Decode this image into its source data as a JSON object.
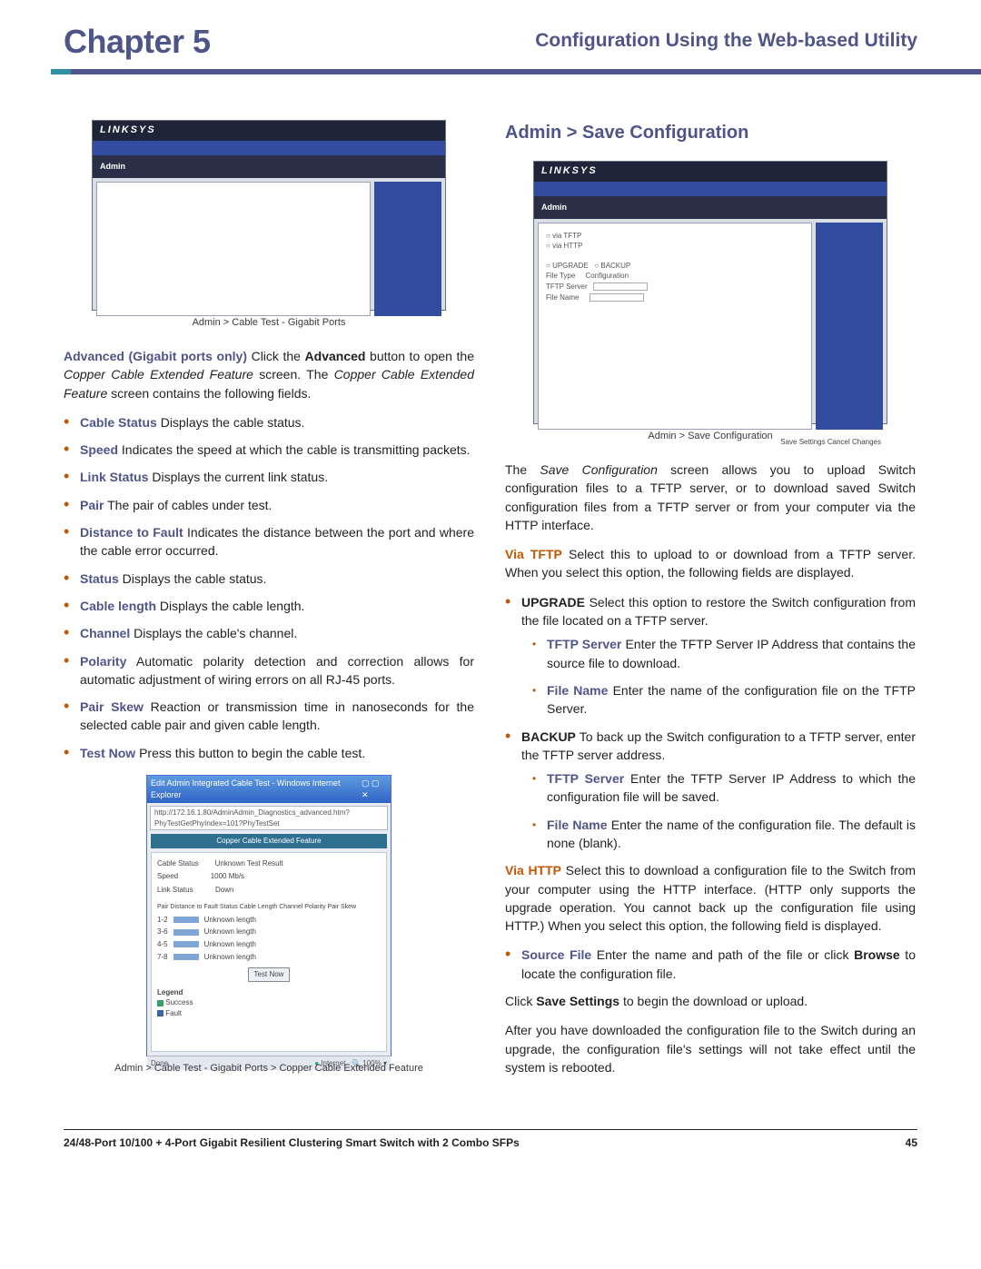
{
  "header": {
    "chapter": "Chapter 5",
    "section": "Configuration Using the Web-based Utility"
  },
  "left": {
    "fig1": {
      "logo": "LINKSYS",
      "nav": "Admin",
      "caption": "Admin > Cable Test - Gigabit Ports"
    },
    "intro": {
      "lead_bold": "Advanced (Gigabit ports only)",
      "lead_rest": " Click the ",
      "lead_bold2": "Advanced",
      "sent2a": " button to open the ",
      "sent2i": "Copper Cable Extended Feature",
      "sent2b": " screen. The ",
      "sent2i2": "Copper Cable Extended Feature",
      "sent2c": " screen contains the following fields."
    },
    "bullets": [
      {
        "term": "Cable Status",
        "text": "  Displays the cable status."
      },
      {
        "term": "Speed",
        "text": " Indicates the speed at which the cable is transmitting packets."
      },
      {
        "term": "Link Status",
        "text": "  Displays the current link status."
      },
      {
        "term": "Pair",
        "text": "  The pair of cables under test."
      },
      {
        "term": "Distance to Fault",
        "text": "  Indicates the distance between the port and where the cable error occurred."
      },
      {
        "term": "Status",
        "text": "  Displays the cable status."
      },
      {
        "term": "Cable length",
        "text": "  Displays the cable length."
      },
      {
        "term": "Channel",
        "text": "  Displays the cable's channel."
      },
      {
        "term": "Polarity",
        "text": "  Automatic polarity detection and correction allows for automatic adjustment of wiring errors on all RJ-45 ports."
      },
      {
        "term": "Pair Skew",
        "text": " Reaction or transmission time in nanoseconds for the selected cable pair and given cable length."
      },
      {
        "term": "Test Now",
        "text": "  Press this button to begin the cable test."
      }
    ],
    "fig2": {
      "title": "Edit Admin Integrated Cable Test - Windows Internet Explorer",
      "addr": "http://172.16.1.80/AdminAdmin_Diagnostics_advanced.htm?PhyTestGetPhyIndex=101?PhyTestSet",
      "section_head": "Copper Cable Extended Feature",
      "fields": {
        "cable_status_l": "Cable Status",
        "cable_status_v": "Unknown Test Result",
        "speed_l": "Speed",
        "speed_v": "1000 Mb/s",
        "link_status_l": "Link Status",
        "link_status_v": "Down"
      },
      "cols": "Pair   Distance to Fault    Status    Cable Length    Channel    Polarity    Pair Skew",
      "rows": [
        "1-2",
        "3-6",
        "4-5",
        "7-8"
      ],
      "row_val": "Unknown length",
      "btn": "Test Now",
      "legend_l": "Legend",
      "legend_s": "Success",
      "legend_f": "Fault",
      "status_l": "Done",
      "status_r_1": "Internet",
      "status_r_2": "100%",
      "caption": "Admin > Cable Test - Gigabit Ports > Copper Cable Extended Feature"
    }
  },
  "right": {
    "heading": "Admin > Save Configuration",
    "fig": {
      "logo": "LINKSYS",
      "nav": "Admin",
      "body_l1": "via TFTP",
      "body_l2": "via HTTP",
      "body_l3_a": "UPGRADE",
      "body_l3_b": "BACKUP",
      "body_l4": "File Type",
      "body_l4v": "Configuration",
      "body_l5": "TFTP Server",
      "body_l6": "File Name",
      "buttons": "Save Settings  Cancel Changes",
      "caption": "Admin > Save Configuration"
    },
    "p1a": "The ",
    "p1i": "Save Configuration",
    "p1b": " screen allows you to upload Switch configuration files to a TFTP server, or to download saved Switch configuration files from a TFTP server or from your computer via the HTTP interface.",
    "p2term": "Via TFTP",
    "p2": "  Select this to upload to or download from a TFTP server. When you select this option, the following fields are displayed.",
    "b1": {
      "term": "UPGRADE",
      "text": "  Select this option to restore the Switch configuration from the file located on a TFTP server.",
      "sub": [
        {
          "term": "TFTP Server",
          "text": "  Enter the TFTP Server IP Address that contains the source file to download."
        },
        {
          "term": "File Name",
          "text": "  Enter the name of the configuration file on the TFTP Server."
        }
      ]
    },
    "b2": {
      "term": "BACKUP",
      "text": "  To back up the Switch configuration to a TFTP server, enter the TFTP server address.",
      "sub": [
        {
          "term": "TFTP Server",
          "text": "  Enter the TFTP Server IP Address to which the configuration file will be saved."
        },
        {
          "term": "File Name",
          "text": "  Enter the name of the configuration file. The default is none (blank)."
        }
      ]
    },
    "p3term": "Via HTTP",
    "p3": "  Select this to download a configuration file to the Switch from your computer using the HTTP interface. (HTTP only supports the upgrade operation. You cannot back up the configuration file using HTTP.) When you select this option, the following field is displayed.",
    "b3": {
      "term": "Source File",
      "text_a": "  Enter the name and path of the file or click ",
      "bold": "Browse",
      "text_b": " to locate the configuration file."
    },
    "p4a": "Click ",
    "p4b": "Save Settings",
    "p4c": " to begin the download or upload.",
    "p5": "After you have downloaded the configuration file to the Switch during an upgrade, the configuration file's settings will not take effect until the system is rebooted."
  },
  "footer": {
    "product": "24/48-Port 10/100 + 4-Port Gigabit Resilient Clustering Smart Switch with 2 Combo SFPs",
    "page": "45"
  }
}
